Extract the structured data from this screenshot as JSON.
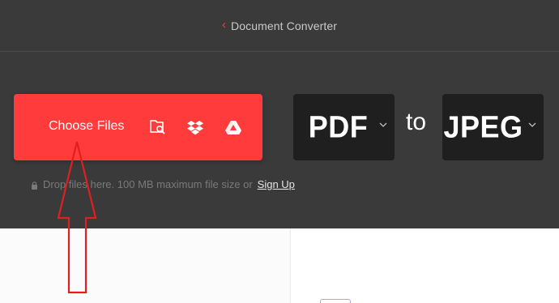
{
  "header": {
    "back_glyph": "‹",
    "title": "Document Converter"
  },
  "upload": {
    "choose_label": "Choose Files",
    "icons": [
      "folder-search-icon",
      "dropbox-icon",
      "google-drive-icon"
    ],
    "hint_text": "Drop files here. 100 MB maximum file size or",
    "signup_label": "Sign Up"
  },
  "converter": {
    "from_format": "PDF",
    "to_label": "to",
    "to_format": "JPEG"
  },
  "colors": {
    "accent": "#ff3b3b",
    "header_bg": "#3a3a3a",
    "format_bg": "#1f1f1f",
    "annotation": "#e02020"
  }
}
